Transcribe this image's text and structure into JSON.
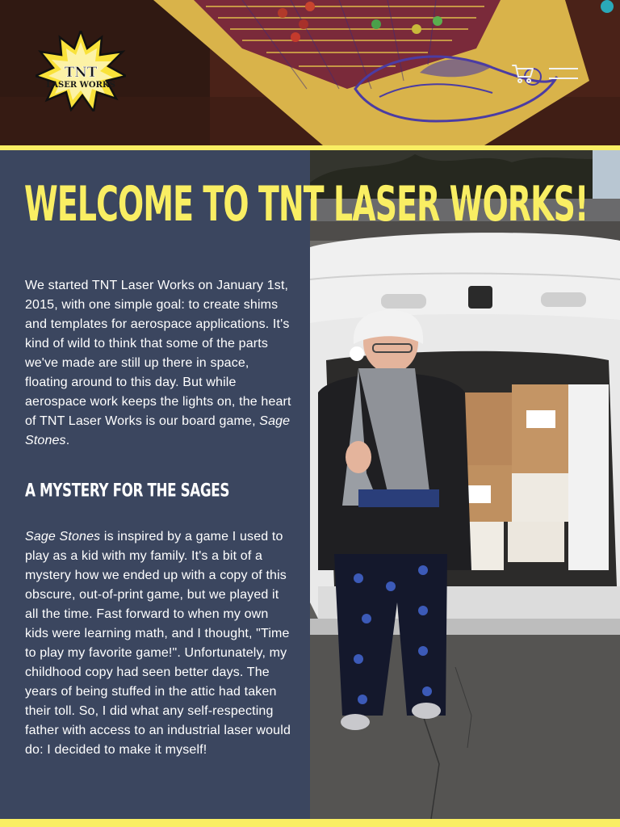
{
  "header": {
    "logo": {
      "line1": "TNT",
      "line2": "LASER WORKS"
    },
    "cart_icon": "shopping-cart-icon",
    "menu_icon": "hamburger-menu-icon"
  },
  "colors": {
    "accent_yellow": "#f9ee63",
    "panel_navy": "#3b465f",
    "text_white": "#ffffff"
  },
  "main": {
    "title": "WELCOME TO TNT LASER WORKS!",
    "para1": {
      "before": "We started TNT Laser Works on January 1st, 2015, with one simple goal: to create shims and templates for aerospace applications. It's kind of wild to think that some of the parts we've made are still up there in space, floating around to this day. But while aerospace work keeps the lights on, the heart of TNT Laser Works is our board game, ",
      "game_name": "Sage Stones",
      "after": "."
    },
    "subheading": "A MYSTERY FOR THE SAGES",
    "para2": {
      "game_name": "Sage Stones",
      "text": " is inspired by a game I used to play as a kid with my family. It's a bit of a mystery how we ended up with a copy of this obscure, out-of-print game, but we played it all the time. Fast forward to when my own kids were learning math, and I thought, \"Time to play my favorite game!\". Unfortunately, my childhood copy had seen better days. The years of being stuffed in the attic had taken their toll. So, I did what any self-respecting father with access to an industrial laser would do: I decided to make it myself!"
    }
  }
}
